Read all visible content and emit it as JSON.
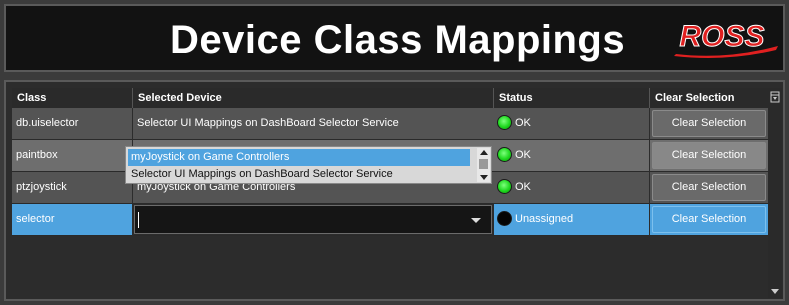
{
  "header": {
    "title": "Device Class Mappings",
    "logo_text": "ROSS"
  },
  "table": {
    "columns": {
      "class": "Class",
      "device": "Selected Device",
      "status": "Status",
      "clear": "Clear Selection"
    },
    "rows": [
      {
        "class": "db.uiselector",
        "device": "Selector UI Mappings on DashBoard Selector Service",
        "status": "OK",
        "button": "Clear Selection"
      },
      {
        "class": "paintbox",
        "device": "myJoystick on Game Controllers",
        "status": "OK",
        "button": "Clear Selection"
      },
      {
        "class": "ptzjoystick",
        "device": "myJoystick on Game Controllers",
        "status": "OK",
        "button": "Clear Selection"
      },
      {
        "class": "selector",
        "device": "",
        "status": "Unassigned",
        "button": "Clear Selection"
      }
    ]
  },
  "dropdown": {
    "options": [
      "myJoystick on Game Controllers",
      "Selector UI Mappings on DashBoard Selector Service"
    ],
    "highlighted": "myJoystick on Game Controllers"
  },
  "colors": {
    "selected_row": "#4fa3df",
    "ok_led": "#1ed81e",
    "logo": "#e02020"
  },
  "icons": [
    "status-led-icon",
    "dropdown-arrow-icon",
    "column-chooser-icon",
    "scroll-up-icon",
    "scroll-down-icon"
  ]
}
